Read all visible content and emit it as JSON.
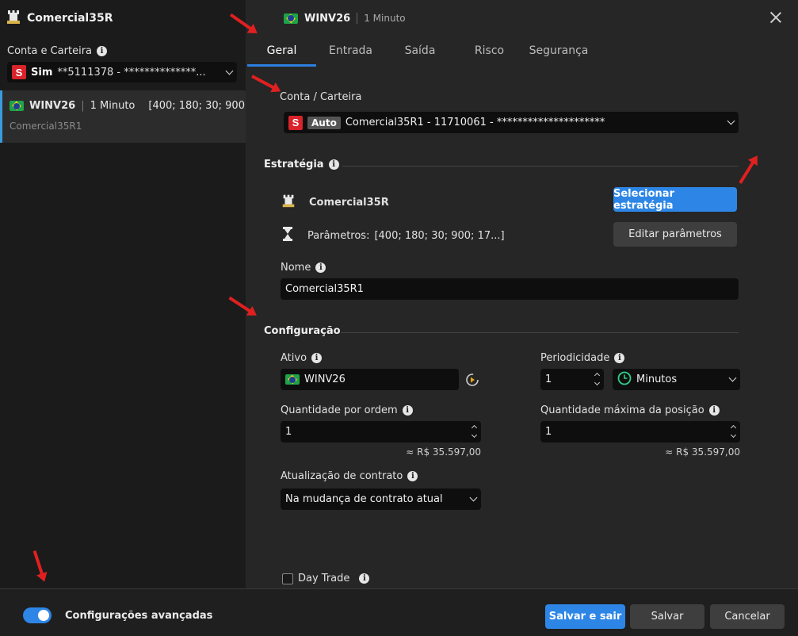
{
  "left_panel": {
    "title": "Comercial35R",
    "account_label": "Conta e Carteira",
    "account_badge": "S",
    "account_type": "Sim",
    "account_mask": "**5111378 - **************...",
    "item": {
      "symbol": "WINV26",
      "period": "1 Minuto",
      "params": "[400; 180; 30; 900...",
      "name": "Comercial35R1"
    }
  },
  "header": {
    "symbol": "WINV26",
    "period": "1 Minuto"
  },
  "tabs": [
    {
      "label": "Geral",
      "active": true
    },
    {
      "label": "Entrada"
    },
    {
      "label": "Saída"
    },
    {
      "label": "Risco"
    },
    {
      "label": "Segurança"
    }
  ],
  "general": {
    "account_section_label": "Conta / Carteira",
    "account_badge": "S",
    "account_auto": "Auto",
    "account_value": "Comercial35R1 - 11710061 - *********************",
    "strategy_section": "Estratégia",
    "strategy_name": "Comercial35R",
    "params_label": "Parâmetros:",
    "params_value": "[400; 180; 30; 900; 17...]",
    "select_strategy_button": "Selecionar estratégia",
    "edit_params_button": "Editar parâmetros",
    "name_label": "Nome",
    "name_value": "Comercial35R1",
    "config_section": "Configuração",
    "asset_label": "Ativo",
    "asset_value": "WINV26",
    "periodicity_label": "Periodicidade",
    "periodicity_value": "1",
    "periodicity_unit": "Minutos",
    "qty_label": "Quantidade por ordem",
    "qty_value": "1",
    "qty_approx": "≈ R$ 35.597,00",
    "max_qty_label": "Quantidade máxima da posição",
    "max_qty_value": "1",
    "max_qty_approx": "≈ R$ 35.597,00",
    "contract_update_label": "Atualização de contrato",
    "contract_update_value": "Na mudança de contrato atual",
    "day_trade_label": "Day Trade"
  },
  "footer": {
    "advanced_label": "Configurações avançadas",
    "save_exit": "Salvar e sair",
    "save": "Salvar",
    "cancel": "Cancelar"
  },
  "colors": {
    "accent": "#2d86e6",
    "badge_red": "#d8232a",
    "annotation_red": "#e02020"
  }
}
